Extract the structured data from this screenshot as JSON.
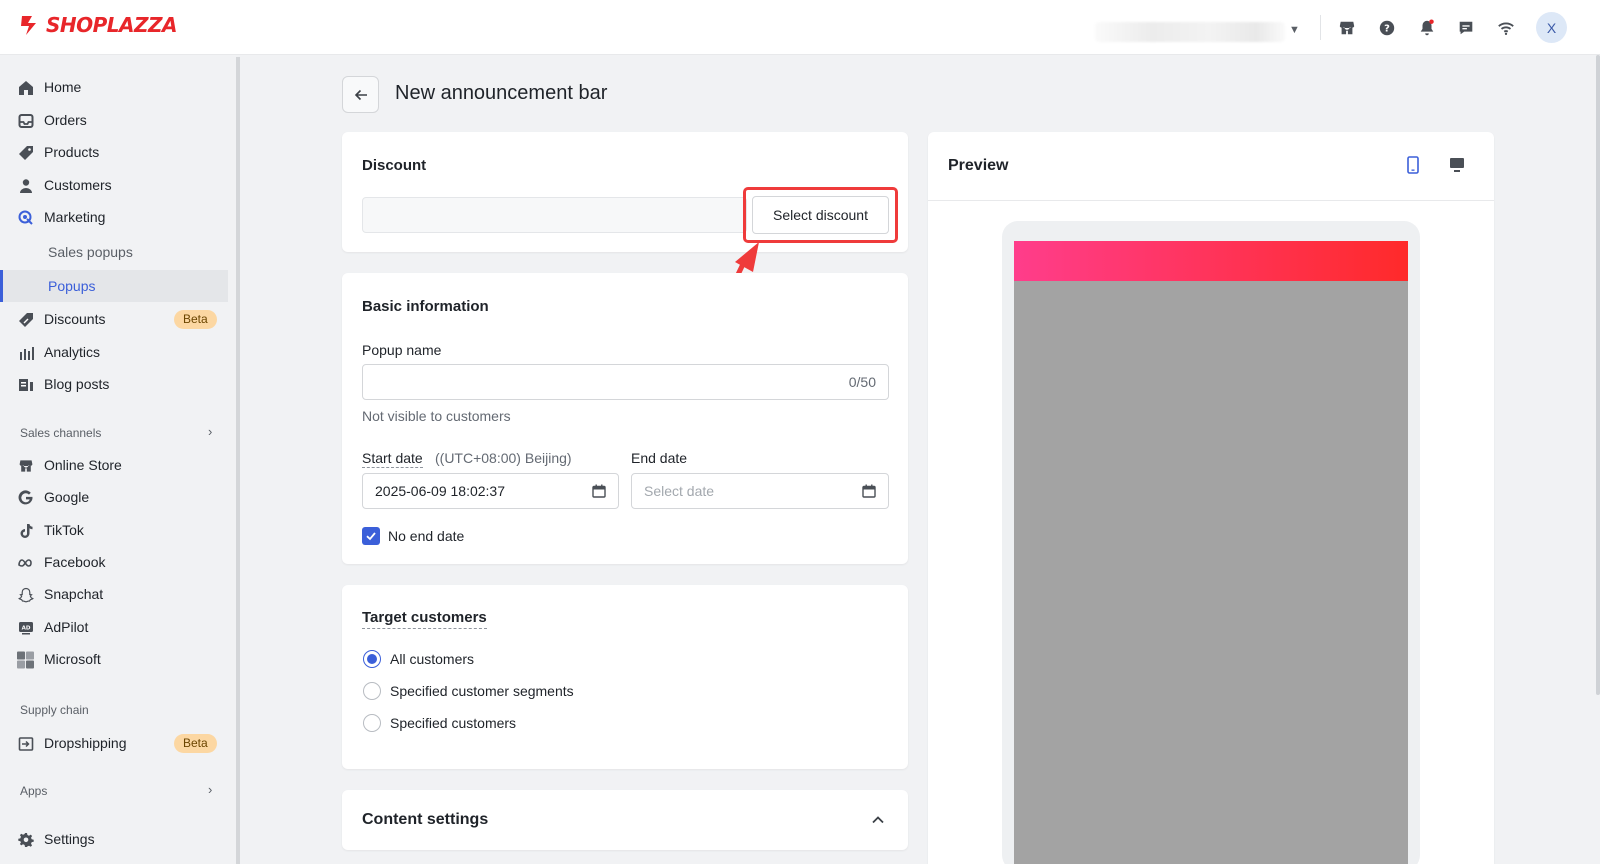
{
  "brand": {
    "name": "SHOPLAZZA",
    "color": "#e8262a"
  },
  "topbar": {
    "icons": [
      "storefront-icon",
      "help-icon",
      "bell-icon",
      "chat-icon",
      "wifi-icon"
    ],
    "avatar_initial": "X"
  },
  "sidebar": {
    "items": [
      {
        "label": "Home",
        "icon": "home-icon"
      },
      {
        "label": "Orders",
        "icon": "inbox-icon"
      },
      {
        "label": "Products",
        "icon": "tag-icon"
      },
      {
        "label": "Customers",
        "icon": "person-icon"
      },
      {
        "label": "Marketing",
        "icon": "target-icon"
      },
      {
        "label": "Discounts",
        "icon": "discount-icon",
        "badge": "Beta"
      },
      {
        "label": "Analytics",
        "icon": "bar-chart-icon"
      },
      {
        "label": "Blog posts",
        "icon": "blog-icon"
      }
    ],
    "marketing_sub": [
      {
        "label": "Sales popups",
        "active": false
      },
      {
        "label": "Popups",
        "active": true
      }
    ],
    "sales_channels_label": "Sales channels",
    "channels": [
      {
        "label": "Online Store",
        "icon": "storefront-icon"
      },
      {
        "label": "Google",
        "icon": "google-icon"
      },
      {
        "label": "TikTok",
        "icon": "tiktok-icon"
      },
      {
        "label": "Facebook",
        "icon": "meta-icon"
      },
      {
        "label": "Snapchat",
        "icon": "snapchat-icon"
      },
      {
        "label": "AdPilot",
        "icon": "adpilot-icon"
      },
      {
        "label": "Microsoft",
        "icon": "microsoft-icon"
      }
    ],
    "supply_chain_label": "Supply chain",
    "dropshipping": {
      "label": "Dropshipping",
      "badge": "Beta"
    },
    "apps_label": "Apps",
    "settings_label": "Settings"
  },
  "page": {
    "title": "New announcement bar"
  },
  "discount": {
    "title": "Discount",
    "select_label": "Select discount"
  },
  "basic_info": {
    "title": "Basic information",
    "popup_name_label": "Popup name",
    "popup_name_value": "",
    "popup_name_counter": "0/50",
    "popup_name_hint": "Not visible to customers",
    "start_date_label": "Start date",
    "timezone": "((UTC+08:00) Beijing)",
    "start_date_value": "2025-06-09 18:02:37",
    "end_date_label": "End date",
    "end_date_placeholder": "Select date",
    "no_end_date_label": "No end date",
    "no_end_date_checked": true
  },
  "target_customers": {
    "title": "Target customers",
    "options": [
      {
        "label": "All customers",
        "selected": true
      },
      {
        "label": "Specified customer segments",
        "selected": false
      },
      {
        "label": "Specified customers",
        "selected": false
      }
    ]
  },
  "content_settings": {
    "title": "Content settings",
    "expanded": true
  },
  "preview": {
    "title": "Preview",
    "active_device": "mobile"
  },
  "colors": {
    "accent": "#3b5fd9",
    "announcement_gradient_start": "#ff3d8b",
    "announcement_gradient_end": "#ff2a2a",
    "highlight": "#ef3b3b"
  }
}
